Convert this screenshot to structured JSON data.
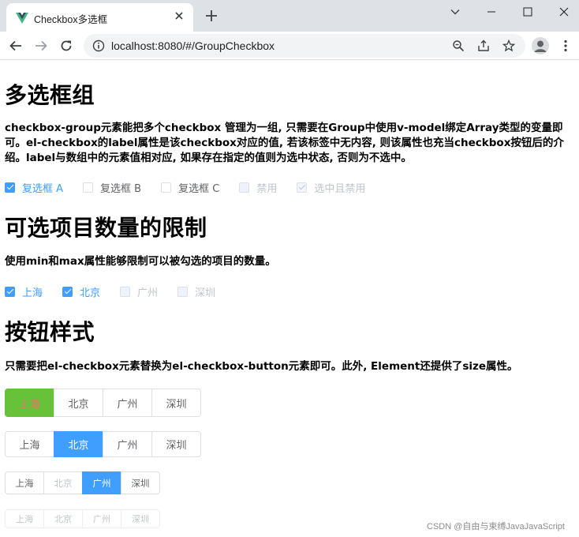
{
  "browser": {
    "tab_title": "Checkbox多选框",
    "tab_close_glyph": "✕",
    "new_tab_glyph": "+",
    "url": "localhost:8080/#/GroupCheckbox",
    "icons": [
      "vue-logo-icon",
      "close-icon",
      "plus-icon",
      "chevron-down-icon",
      "minimize-icon",
      "maximize-icon",
      "close-window-icon",
      "back-arrow-icon",
      "forward-arrow-icon",
      "reload-icon",
      "info-icon",
      "zoom-icon",
      "share-icon",
      "star-icon",
      "profile-icon",
      "more-vert-icon"
    ]
  },
  "section1": {
    "title": "多选框组",
    "desc": "checkbox-group元素能把多个checkbox 管理为一组, 只需要在Group中使用v-model绑定Array类型的变量即可。el-checkbox的label属性是该checkbox对应的值, 若该标签中无内容, 则该属性也充当checkbox按钮后的介绍。label与数组中的元素值相对应, 如果存在指定的值则为选中状态, 否则为不选中。",
    "options": [
      {
        "label": "复选框 A",
        "checked": true,
        "disabled": false
      },
      {
        "label": "复选框 B",
        "checked": false,
        "disabled": false
      },
      {
        "label": "复选框 C",
        "checked": false,
        "disabled": false
      },
      {
        "label": "禁用",
        "checked": false,
        "disabled": true
      },
      {
        "label": "选中且禁用",
        "checked": true,
        "disabled": true
      }
    ]
  },
  "section2": {
    "title": "可选项目数量的限制",
    "desc": "使用min和max属性能够限制可以被勾选的项目的数量。",
    "options": [
      {
        "label": "上海",
        "checked": true,
        "disabled": false
      },
      {
        "label": "北京",
        "checked": true,
        "disabled": false
      },
      {
        "label": "广州",
        "checked": false,
        "disabled": true
      },
      {
        "label": "深圳",
        "checked": false,
        "disabled": true
      }
    ]
  },
  "section3": {
    "title": "按钮样式",
    "desc": "只需要把el-checkbox元素替换为el-checkbox-button元素即可。此外, Element还提供了size属性。",
    "groups": [
      [
        "上海",
        "北京",
        "广州",
        "深圳"
      ],
      [
        "上海",
        "北京",
        "广州",
        "深圳"
      ],
      [
        "上海",
        "北京",
        "广州",
        "深圳"
      ],
      [
        "上海",
        "北京",
        "广州",
        "深圳"
      ]
    ]
  },
  "watermark": "CSDN @自由与束缚JavaJavaScript",
  "colors": {
    "primary": "#409eff",
    "success": "#67c23a",
    "danger": "#f56c6c",
    "disabled": "#c0c4cc",
    "text": "#606266"
  }
}
